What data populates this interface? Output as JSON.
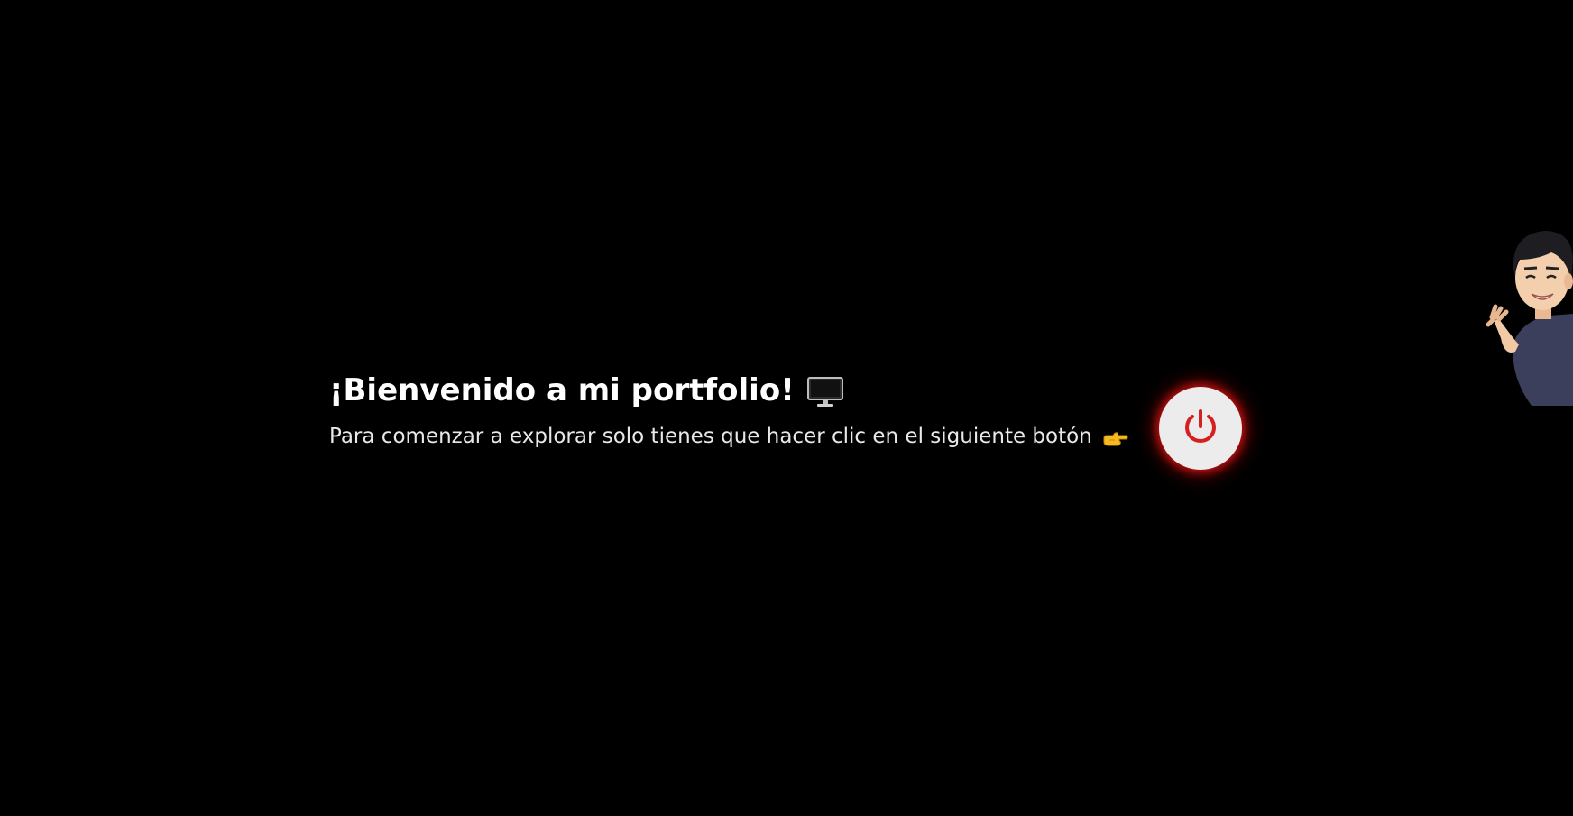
{
  "welcome": {
    "title": "¡Bienvenido a mi portfolio!",
    "subtitle": "Para comenzar a explorar solo tienes que hacer clic en el siguiente botón"
  },
  "icons": {
    "title_icon": "monitor-icon",
    "subtitle_icon": "pointing-hand-icon",
    "button_icon": "power-icon"
  },
  "colors": {
    "background": "#000000",
    "text": "#ffffff",
    "power_button_bg": "#ececec",
    "power_icon": "#d61f1f",
    "glow": "#dc1414"
  }
}
